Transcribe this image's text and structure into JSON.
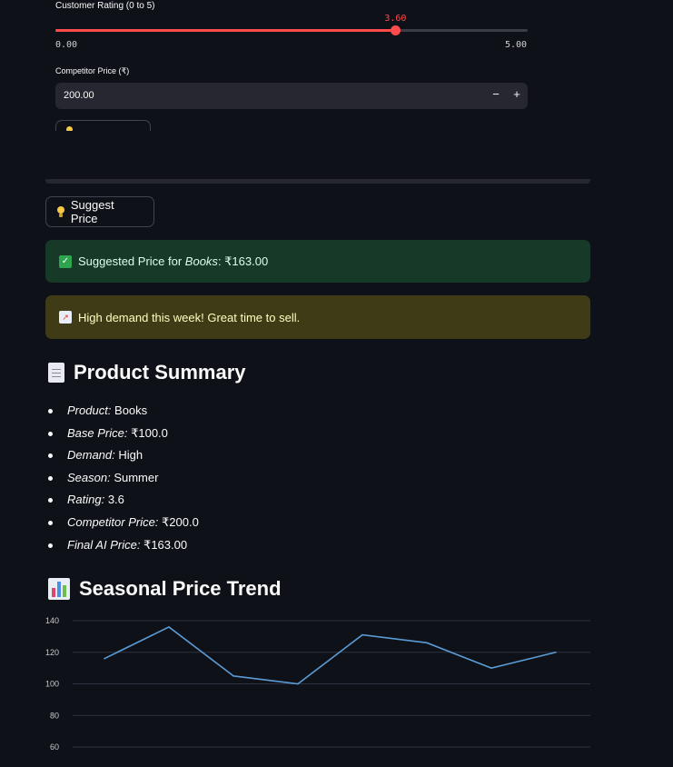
{
  "rating": {
    "label": "Customer Rating (0 to 5)",
    "value": 3.6,
    "value_text": "3.60",
    "min_text": "0.00",
    "max_text": "5.00",
    "min": 0,
    "max": 5
  },
  "competitor": {
    "label": "Competitor Price (₹)",
    "value": "200.00",
    "minus": "−",
    "plus": "+"
  },
  "suggest_button": {
    "label": "Suggest Price",
    "icon": "lightbulb-icon"
  },
  "alerts": {
    "success": {
      "icon": "check-box-icon",
      "prefix": "Suggested Price for ",
      "product": "Books",
      "suffix": ": ₹163.00",
      "color": "#173928"
    },
    "warning": {
      "icon": "chart-increasing-icon",
      "text": "High demand this week! Great time to sell.",
      "color": "#3e3b16"
    }
  },
  "summary": {
    "icon": "page-icon",
    "title": "Product Summary",
    "items": [
      {
        "key": "Product:",
        "value": " Books"
      },
      {
        "key": "Base Price:",
        "value": " ₹100.0"
      },
      {
        "key": "Demand:",
        "value": " High"
      },
      {
        "key": "Season:",
        "value": " Summer"
      },
      {
        "key": "Rating:",
        "value": " 3.6"
      },
      {
        "key": "Competitor Price:",
        "value": " ₹200.0"
      },
      {
        "key": "Final AI Price:",
        "value": " ₹163.00"
      }
    ]
  },
  "trend": {
    "icon": "bar-chart-icon",
    "title": "Seasonal Price Trend"
  },
  "chart_data": {
    "type": "line",
    "series": [
      {
        "color": "#5b9bd5",
        "values": [
          116,
          136,
          105,
          100,
          131,
          126,
          110,
          120
        ]
      }
    ],
    "yticks": [
      140,
      120,
      100,
      80,
      60
    ],
    "ylim": [
      60,
      140
    ],
    "grid": true
  }
}
